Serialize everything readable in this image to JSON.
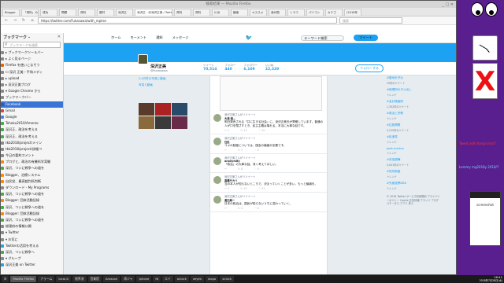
{
  "browser": {
    "title": "検索結果 — Mozilla Firefox",
    "tabs": [
      "Blogger",
      "「資料」の",
      "成功",
      "問題",
      "資料",
      "藤村",
      "深沢正",
      "深沢正 - @深沢正美 / Twitter",
      "資料",
      "資料",
      "川派",
      "議案",
      "オススメ",
      "我が国",
      "トラコ",
      "パソコン",
      "カテゴ",
      "(2018年"
    ],
    "url": "https://twitter.com/Fukasawa/with_replies",
    "search_placeholder": "検索",
    "back": "←",
    "forward": "→",
    "reload": "↻",
    "home": "⌂"
  },
  "sidebar": {
    "title": "ブックマーク –",
    "close": "✕",
    "search_placeholder": "ブックマークを検索",
    "items": [
      {
        "label": "▸ ブックマークツールバー",
        "color": "#888"
      },
      {
        "label": "▸ よく見るページ",
        "color": "#888"
      },
      {
        "label": "Firefox を使いこなそう",
        "color": "#e66000"
      },
      {
        "label": "☐ 深沢 正美・平和メディ",
        "color": "#888"
      },
      {
        "label": "▸ upload",
        "color": "#888"
      },
      {
        "label": "▸ 深沢正美ブログ",
        "color": "#888"
      },
      {
        "label": "▾ Google Chrome から",
        "color": "#888"
      },
      {
        "label": "ブックマークバー",
        "color": "#888"
      },
      {
        "label": "Facebook",
        "color": "#3b5998",
        "selected": true
      },
      {
        "label": "Gmail",
        "color": "#d44"
      },
      {
        "label": "Google",
        "color": "#4285f4"
      },
      {
        "label": "Tohoku2010/Amerzo",
        "color": "#4a4"
      },
      {
        "label": "深沢正、政治を考える",
        "color": "#4a4"
      },
      {
        "label": "深沢正、政治を考える",
        "color": "#4a4"
      },
      {
        "label": "tkb2018/project/メイン",
        "color": "#888"
      },
      {
        "label": "tkb2018/project/詳細ペ",
        "color": "#888"
      },
      {
        "label": "今日の要約コメント",
        "color": "#888"
      },
      {
        "label": "ブログと、政治の有機科学実験",
        "color": "#f80"
      },
      {
        "label": "深沢、ついに戦争への道を",
        "color": "#4a4"
      },
      {
        "label": "Blogger、治療システム",
        "color": "#f80"
      },
      {
        "label": "自民党、最高裁判所判断",
        "color": "#f80"
      },
      {
        "label": "ダウンロード - My Programs",
        "color": "#888"
      },
      {
        "label": "深沢、ついに戦争への道を",
        "color": "#4a4"
      },
      {
        "label": "Blogger: 団体活動記録",
        "color": "#f80"
      },
      {
        "label": "深沢、ついに戦争への道を",
        "color": "#4a4"
      },
      {
        "label": "Blogger: 団体活動記録",
        "color": "#f80"
      },
      {
        "label": "深沢、ついに戦争への道を",
        "color": "#4a4"
      },
      {
        "label": "総理府の情報公開",
        "color": "#888"
      },
      {
        "label": "▾ Twitter",
        "color": "#888"
      },
      {
        "label": "▾ お気に",
        "color": "#888"
      },
      {
        "label": "Twitterの活用を考える",
        "color": "#1da1f2"
      },
      {
        "label": "深沢、ついに戦争へ",
        "color": "#4a4"
      },
      {
        "label": "▾ グループ",
        "color": "#888"
      },
      {
        "label": "深沢正美 on Twitter",
        "color": "#1da1f2"
      }
    ]
  },
  "twitter": {
    "nav": [
      "ホーム",
      "モーメント",
      "通知",
      "メッセージ"
    ],
    "search_placeholder": "キーワード検索",
    "tweet_button": "ツイート",
    "profile_name": "深沢正美",
    "profile_handle": "@fukasawa",
    "stats": [
      {
        "label": "ツイート",
        "value": "70,514"
      },
      {
        "label": "フォロー",
        "value": "440"
      },
      {
        "label": "フォロワー",
        "value": "6,109"
      },
      {
        "label": "いいね",
        "value": "22,329"
      }
    ],
    "follow_button": "フォローする",
    "left_links": [
      "2,4万件の写真と動画",
      "写真と動画"
    ],
    "tweets": [
      {
        "meta": "深沢正美さんがリツイート",
        "name": "大浦 純—",
        "body": "明日発売される「共に生きる社会」に、深沢正美氏が寄稿しています。普通の人が口を閉ざすとき、民主主義は壊れる。本当に大事な話です。",
        "acts": [
          "↩ 1",
          "↻ 12",
          "♡ 20"
        ]
      },
      {
        "meta": "深沢正美さんがリツイート",
        "name": "住民",
        "body": "コメの制度については、国会の議論が必要です。",
        "acts": [
          "↩",
          "↻ 3",
          "♡ 4"
        ]
      },
      {
        "meta": "深沢正美さんがリツイート",
        "name": "anonymity",
        "body": "「政治」の大事な話。深く考えてほしい。",
        "acts": [
          "↩",
          "↻ 8",
          "♡ 9"
        ]
      },
      {
        "meta": "深沢正美さんがリツイート",
        "name": "高橋サカリ",
        "body": "当の本人が知らないところで、決まっていくことが多い。もっと議論を。",
        "acts": [
          "↩ 2",
          "↻ 15",
          "♡ 31"
        ]
      },
      {
        "meta": "深沢正美さんがリツイート",
        "name": "渡辺純一",
        "body": "日本の政治は、国民が知らないうちに変わっていく。",
        "acts": [
          "↩",
          "↻ 4",
          "♡ 6"
        ]
      }
    ],
    "right_links": [
      {
        "link": "#聖地を守れ",
        "meta": "10件のツイート"
      },
      {
        "link": "#総理府のダメ出し",
        "meta": "トレンド"
      },
      {
        "link": "#会計検査院",
        "meta": "1,302件のツイート"
      },
      {
        "link": "#政治と宗教",
        "meta": "トレンド"
      },
      {
        "link": "#拉致問題",
        "meta": "2,215件のツイート"
      },
      {
        "link": "#民進党",
        "meta": "トレンド"
      },
      {
        "link": "post-marine",
        "meta": "トレンド"
      },
      {
        "link": "#安倍退陣",
        "meta": "5,041件のツイート"
      },
      {
        "link": "#死刑制度",
        "meta": "トレンド"
      },
      {
        "link": "#先極投票DBX",
        "meta": "トレンド"
      }
    ],
    "footer": "© 2018 Twitter サービス利用規約 プライバシーポリシー Cookie 広告情報 ブランド ブログ ステータス アプリ 求人"
  },
  "desktop": {
    "text1": "Tweet add mysql uma f",
    "text2": "Lemmy mg2018y 2018/7",
    "winbox_label": "screenshot"
  },
  "taskbar": {
    "items": [
      "☰",
      "Mozilla Firefox",
      "アラーム",
      "local-ti",
      "限界流",
      "営業提",
      "Amazon",
      "再ジャ",
      "iphone",
      "fb",
      "エイ",
      "oclock",
      "xeyes",
      "xlogo",
      "xclock"
    ],
    "time": "16:41",
    "date": "2018年7月28日(水)"
  },
  "colors": {
    "accent": "#1da1f2",
    "desktop": "#6b1ea6"
  }
}
